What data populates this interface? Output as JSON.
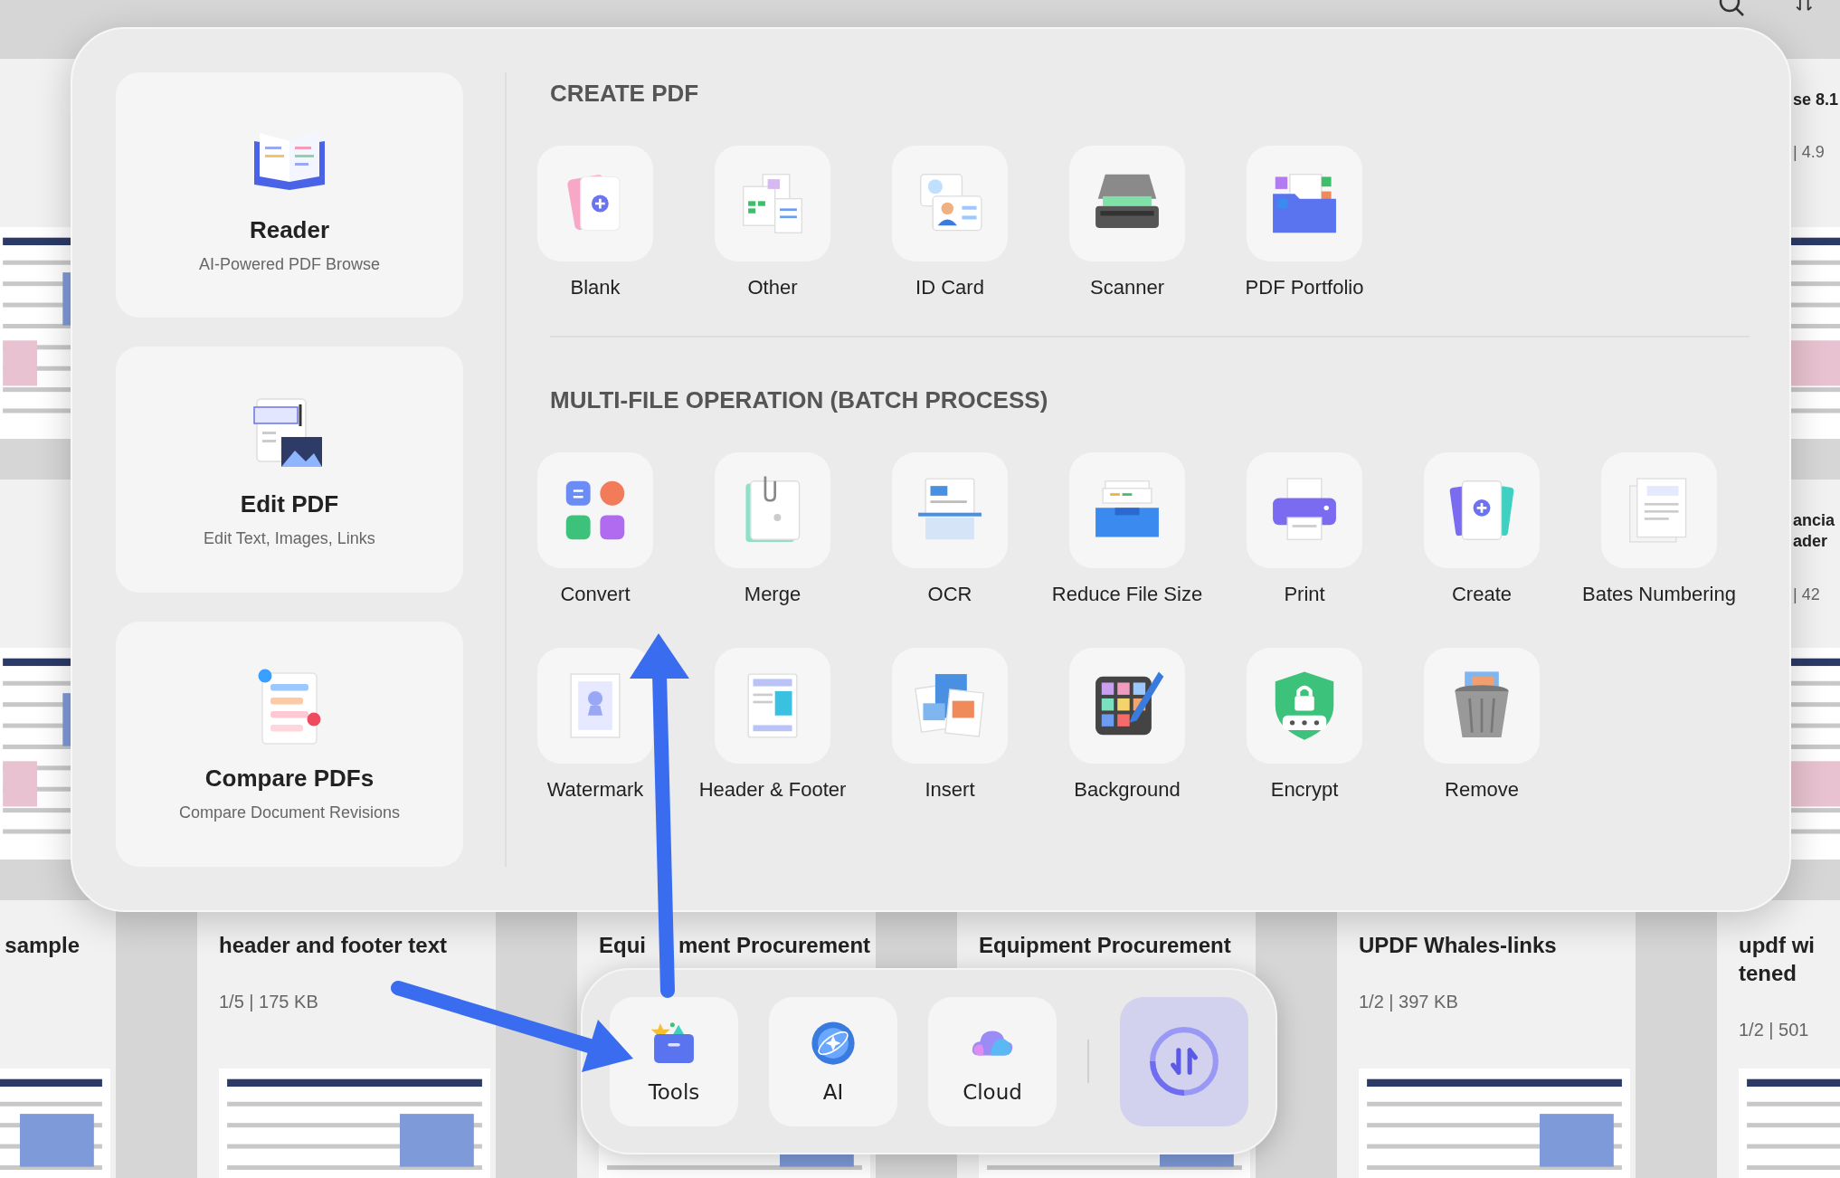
{
  "background_files": [
    {
      "cards": [
        {
          "kind": "file"
        },
        {
          "kind": "file",
          "title": [
            [
              "se 8.1"
            ]
          ],
          "meta": "| 4.9"
        }
      ]
    },
    {
      "cards": [
        {
          "kind": "file"
        },
        {
          "kind": "file",
          "title": [
            [
              "ancia"
            ],
            [
              "ader"
            ]
          ],
          "meta": "| 42"
        }
      ]
    },
    {
      "cards": [
        {
          "kind": "file",
          "title": [
            [
              "sample"
            ]
          ]
        },
        {
          "kind": "file",
          "title": [
            [
              "header and footer text"
            ]
          ],
          "meta": "1/5 | 175 KB"
        },
        {
          "kind": "file",
          "title": [
            [
              "Equi",
              "ment Procurement"
            ]
          ]
        },
        {
          "kind": "file",
          "title": [
            [
              "Equipment Procurement"
            ]
          ]
        },
        {
          "kind": "file",
          "title": [
            [
              "UPDF Whales-links"
            ]
          ],
          "meta": "1/2 | 397 KB"
        },
        {
          "kind": "file",
          "title": [
            [
              "updf wi"
            ],
            [
              "tened"
            ]
          ],
          "meta": "1/2 | 501"
        }
      ]
    }
  ],
  "launcher": {
    "modes": [
      {
        "title": "Reader",
        "subtitle": "AI-Powered PDF Browse"
      },
      {
        "title": "Edit PDF",
        "subtitle": "Edit Text, Images, Links"
      },
      {
        "title": "Compare PDFs",
        "subtitle": "Compare Document Revisions"
      }
    ],
    "sections": [
      {
        "title": "CREATE PDF",
        "tools": [
          "Blank",
          "Other",
          "ID Card",
          "Scanner",
          "PDF Portfolio"
        ]
      },
      {
        "title": "MULTI-FILE OPERATION (BATCH PROCESS)",
        "tools": [
          "Convert",
          "Merge",
          "OCR",
          "Reduce File Size",
          "Print",
          "Create",
          "Bates Numbering",
          "Watermark",
          "Header & Footer",
          "Insert",
          "Background",
          "Encrypt",
          "Remove"
        ]
      }
    ]
  },
  "dock": {
    "items": [
      "Tools",
      "AI",
      "Cloud"
    ]
  }
}
